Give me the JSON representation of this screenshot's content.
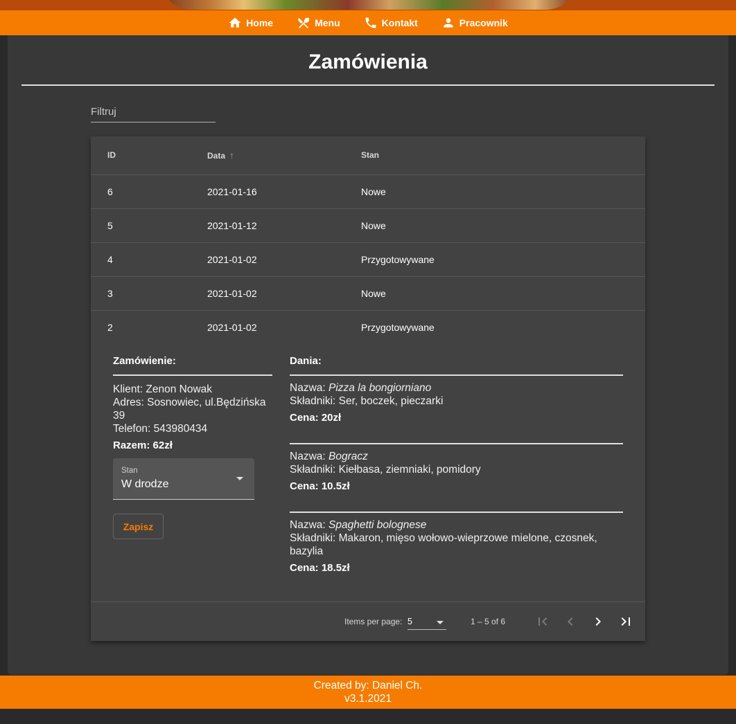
{
  "nav": {
    "items": [
      {
        "label": "Home",
        "icon": "home-icon"
      },
      {
        "label": "Menu",
        "icon": "cutlery-icon"
      },
      {
        "label": "Kontakt",
        "icon": "phone-icon"
      },
      {
        "label": "Pracownik",
        "icon": "person-icon"
      }
    ]
  },
  "page": {
    "title": "Zamówienia"
  },
  "filter": {
    "placeholder": "Filtruj",
    "value": ""
  },
  "table": {
    "headers": {
      "id": "ID",
      "data": "Data",
      "stan": "Stan"
    },
    "rows": [
      {
        "id": "6",
        "data": "2021-01-16",
        "stan": "Nowe"
      },
      {
        "id": "5",
        "data": "2021-01-12",
        "stan": "Nowe"
      },
      {
        "id": "4",
        "data": "2021-01-02",
        "stan": "Przygotowywane"
      },
      {
        "id": "3",
        "data": "2021-01-02",
        "stan": "Nowe"
      },
      {
        "id": "2",
        "data": "2021-01-02",
        "stan": "Przygotowywane"
      }
    ]
  },
  "detail": {
    "order_heading": "Zamówienie:",
    "client": "Klient: Zenon Nowak",
    "address": "Adres: Sosnowiec, ul.Będzińska 39",
    "phone": "Telefon: 543980434",
    "total": "Razem: 62zł",
    "stan_label": "Stan",
    "stan_value": "W drodze",
    "save_label": "Zapisz",
    "dishes_heading": "Dania:",
    "name_prefix": "Nazwa: ",
    "dishes": [
      {
        "name": "Pizza la bongiorniano",
        "ingredients": "Składniki: Ser, boczek, pieczarki",
        "price": "Cena: 20zł"
      },
      {
        "name": "Bogracz",
        "ingredients": "Składniki: Kiełbasa, ziemniaki, pomidory",
        "price": "Cena: 10.5zł"
      },
      {
        "name": "Spaghetti bolognese",
        "ingredients": "Składniki: Makaron, mięso wołowo-wieprzowe mielone, czosnek, bazylia",
        "price": "Cena: 18.5zł"
      }
    ]
  },
  "paginator": {
    "items_per_page_label": "Items per page:",
    "page_size": "5",
    "range": "1 – 5 of 6"
  },
  "footer": {
    "line1": "Created by: Daniel Ch.",
    "line2": "v3.1.2021"
  },
  "colors": {
    "accent": "#f57c00",
    "background": "#2a2a2a",
    "card": "#383838",
    "table": "#424242"
  }
}
